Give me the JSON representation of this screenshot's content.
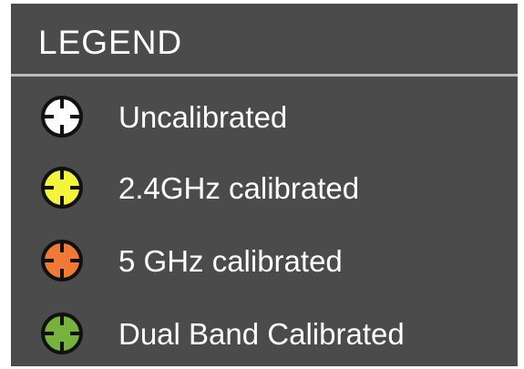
{
  "legend": {
    "title": "LEGEND",
    "items": [
      {
        "label": "Uncalibrated",
        "icon": "crosshair-icon-white",
        "color": "#ffffff"
      },
      {
        "label": "2.4GHz calibrated",
        "icon": "crosshair-icon-yellow",
        "color": "#f4f53a"
      },
      {
        "label": "5 GHz calibrated",
        "icon": "crosshair-icon-orange",
        "color": "#f07a35"
      },
      {
        "label": "Dual Band Calibrated",
        "icon": "crosshair-icon-green",
        "color": "#77b23f"
      }
    ]
  }
}
